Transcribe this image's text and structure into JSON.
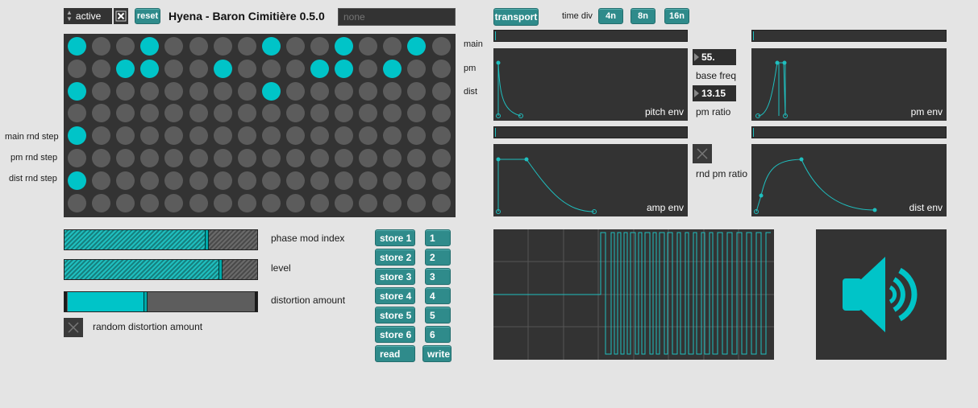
{
  "header": {
    "state_menu_value": "active",
    "reset_label": "reset",
    "title": "Hyena - Baron Cimitière 0.5.0",
    "preset_name_placeholder": "none"
  },
  "transport": {
    "button_label": "transport",
    "time_div_label": "time div",
    "divisions": [
      "4n",
      "8n",
      "16n"
    ]
  },
  "grid": {
    "row_labels_right": [
      "main",
      "pm",
      "dist"
    ],
    "row_labels_left": [
      "main rnd step",
      "pm rnd step",
      "dist rnd step"
    ],
    "rows": [
      [
        1,
        0,
        0,
        1,
        0,
        0,
        0,
        0,
        1,
        0,
        0,
        1,
        0,
        0,
        1,
        0
      ],
      [
        0,
        0,
        1,
        1,
        0,
        0,
        1,
        0,
        0,
        0,
        1,
        1,
        0,
        1,
        0,
        0
      ],
      [
        1,
        0,
        0,
        0,
        0,
        0,
        0,
        0,
        1,
        0,
        0,
        0,
        0,
        0,
        0,
        0
      ],
      [
        0,
        0,
        0,
        0,
        0,
        0,
        0,
        0,
        0,
        0,
        0,
        0,
        0,
        0,
        0,
        0
      ],
      [
        1,
        0,
        0,
        0,
        0,
        0,
        0,
        0,
        0,
        0,
        0,
        0,
        0,
        0,
        0,
        0
      ],
      [
        0,
        0,
        0,
        0,
        0,
        0,
        0,
        0,
        0,
        0,
        0,
        0,
        0,
        0,
        0,
        0
      ],
      [
        1,
        0,
        0,
        0,
        0,
        0,
        0,
        0,
        0,
        0,
        0,
        0,
        0,
        0,
        0,
        0
      ],
      [
        0,
        0,
        0,
        0,
        0,
        0,
        0,
        0,
        0,
        0,
        0,
        0,
        0,
        0,
        0,
        0
      ]
    ]
  },
  "sliders": {
    "phase_mod_index": {
      "label": "phase mod index",
      "value": 0.73
    },
    "level": {
      "label": "level",
      "value": 0.8
    },
    "distortion_amount": {
      "label": "distortion amount",
      "value": 0.41
    }
  },
  "random_distortion_label": "random distortion amount",
  "presets": {
    "store_labels": [
      "store 1",
      "store 2",
      "store 3",
      "store 4",
      "store 5",
      "store 6"
    ],
    "recall_labels": [
      "1",
      "2",
      "3",
      "4",
      "5",
      "6"
    ],
    "read_label": "read",
    "write_label": "write"
  },
  "envelopes": {
    "pitch_env": "pitch env",
    "pm_env": "pm env",
    "amp_env": "amp env",
    "dist_env": "dist env"
  },
  "params": {
    "base_freq_value": "55.",
    "base_freq_label": "base freq",
    "pm_ratio_value": "13.15",
    "pm_ratio_label": "pm ratio",
    "rnd_pm_ratio_label": "rnd pm ratio"
  },
  "colors": {
    "accent": "#00c4c8",
    "button": "#2f8b8b",
    "panel": "#333333",
    "background": "#e4e4e4"
  },
  "icons": {
    "speaker": "speaker-on-icon"
  }
}
